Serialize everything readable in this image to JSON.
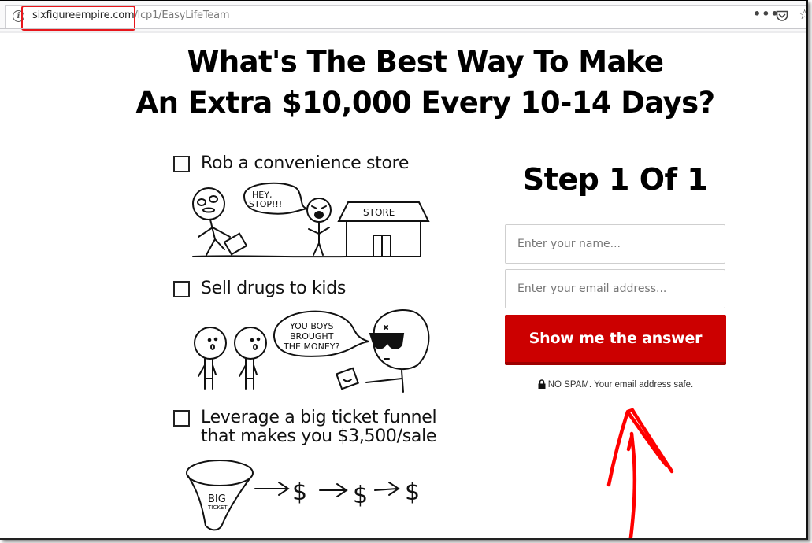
{
  "browser": {
    "url_domain": "sixfigureempire.com",
    "url_path": "/lcp1/EasyLifeTeam",
    "icons": [
      "info-icon",
      "more-actions-icon",
      "pocket-icon",
      "bookmark-star-icon"
    ],
    "highlight_color": "#e8161b"
  },
  "headline": {
    "line1": "What's The Best Way To Make",
    "line2": "An Extra $10,000 Every 10-14 Days?"
  },
  "options": [
    {
      "label": "Rob a convenience store",
      "checked": false,
      "illustration": {
        "speech": "HEY, STOP!!!",
        "sign": "STORE"
      }
    },
    {
      "label": "Sell drugs to kids",
      "checked": false,
      "illustration": {
        "speech": "YOU BOYS BROUGHT THE MONEY?"
      }
    },
    {
      "label_line1": "Leverage a big ticket funnel",
      "label_line2": "that makes you $3,500/sale",
      "checked": false,
      "illustration": {
        "funnel_big": "BIG",
        "funnel_small": "TICKET",
        "sequence": [
          "$",
          "$",
          "$"
        ]
      }
    }
  ],
  "form": {
    "title": "Step 1 Of 1",
    "name_placeholder": "Enter your name...",
    "name_value": "",
    "email_placeholder": "Enter your email address...",
    "email_value": "",
    "submit_label": "Show me the answer",
    "privacy_note": "NO SPAM. Your email address safe.",
    "button_color": "#cc0000",
    "annotation_arrow_color": "#ff0000"
  }
}
